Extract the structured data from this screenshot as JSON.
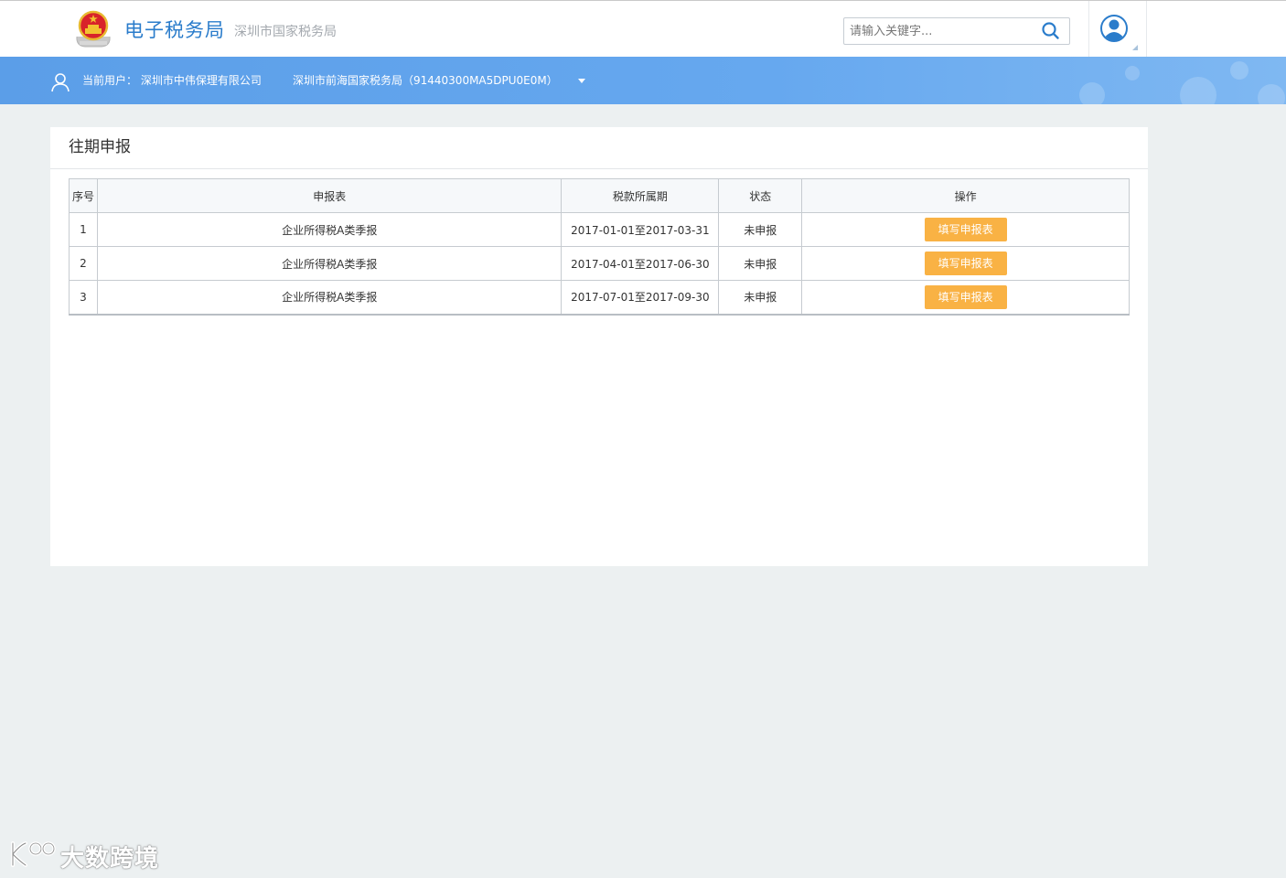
{
  "header": {
    "brand_title": "电子税务局",
    "brand_subtitle": "深圳市国家税务局",
    "search_placeholder": "请输入关键字...",
    "accent_color": "#2a7ccb"
  },
  "user_bar": {
    "current_user": "当前用户： 深圳市中伟保理有限公司",
    "bureau": "深圳市前海国家税务局（91440300MA5DPU0E0M）"
  },
  "panel": {
    "title": "往期申报",
    "columns": [
      "序号",
      "申报表",
      "税款所属期",
      "状态",
      "操作"
    ],
    "rows": [
      {
        "no": "1",
        "form": "企业所得税A类季报",
        "period": "2017-01-01至2017-03-31",
        "status": "未申报",
        "action": "填写申报表"
      },
      {
        "no": "2",
        "form": "企业所得税A类季报",
        "period": "2017-04-01至2017-06-30",
        "status": "未申报",
        "action": "填写申报表"
      },
      {
        "no": "3",
        "form": "企业所得税A类季报",
        "period": "2017-07-01至2017-09-30",
        "status": "未申报",
        "action": "填写申报表"
      }
    ],
    "button_color": "#f9b244"
  },
  "watermark": {
    "text": "大数跨境"
  }
}
